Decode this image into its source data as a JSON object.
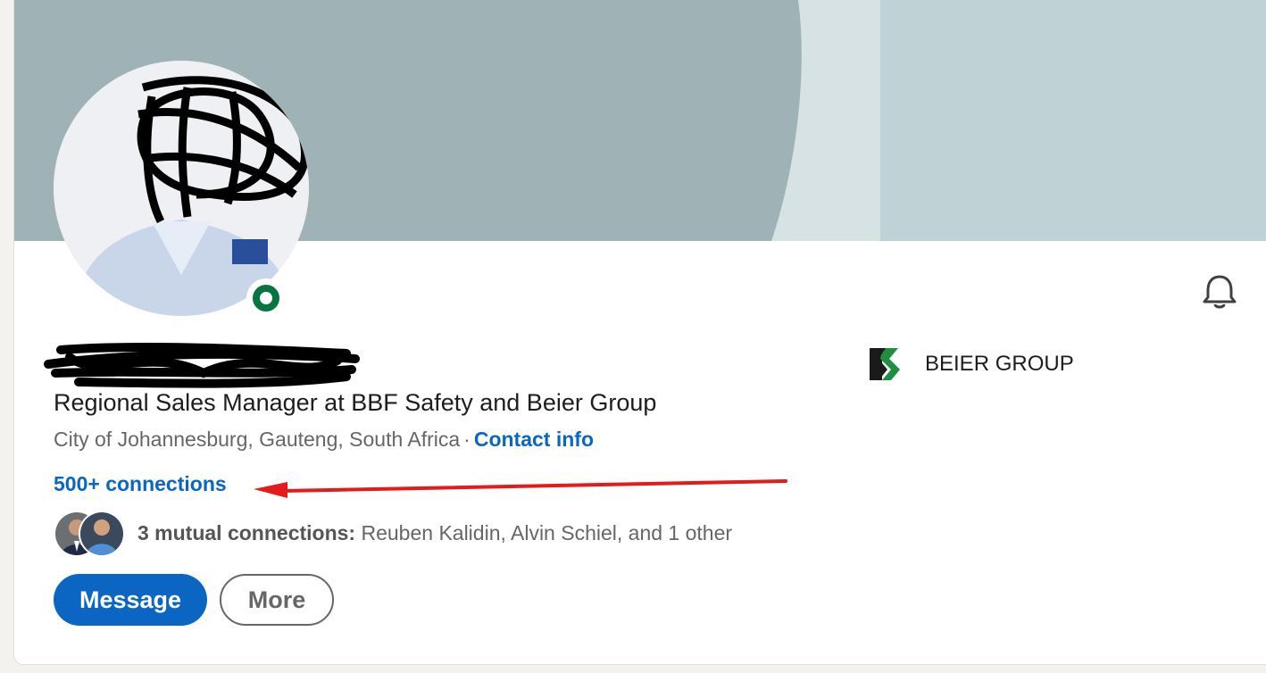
{
  "profile": {
    "headline": "Regional Sales Manager at BBF Safety and Beier Group",
    "location": "City of Johannesburg, Gauteng, South Africa",
    "separator": "·",
    "contact_info_label": "Contact info",
    "connections_label": "500+ connections",
    "online_status": "online"
  },
  "mutual": {
    "label": "3 mutual connections:",
    "names": "Reuben Kalidin, Alvin Schiel, and 1 other"
  },
  "actions": {
    "message_label": "Message",
    "more_label": "More"
  },
  "company": {
    "name": "BEIER GROUP"
  },
  "icons": {
    "notification": "bell-icon",
    "company_logo": "beier-logo-icon"
  },
  "colors": {
    "accent": "#0a66c2",
    "online": "#057642",
    "annotation_arrow": "#e31b1b"
  }
}
